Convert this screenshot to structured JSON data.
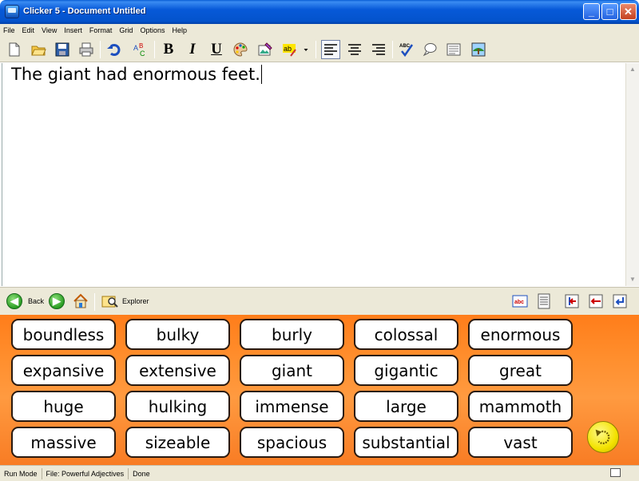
{
  "window": {
    "title": "Clicker 5 - Document Untitled",
    "controls": {
      "minimize": "_",
      "maximize": "□",
      "close": "✕"
    }
  },
  "menu": [
    "File",
    "Edit",
    "View",
    "Insert",
    "Format",
    "Grid",
    "Options",
    "Help"
  ],
  "toolbar": {
    "items": [
      "new-document-icon",
      "open-folder-icon",
      "save-disk-icon",
      "print-icon",
      "undo-icon",
      "spell-letters-icon",
      "bold",
      "italic",
      "underline",
      "colour-palette-icon",
      "picture-paint-icon",
      "highlight-ab-icon",
      "dropdown-arrow-icon",
      "align-left-icon",
      "align-center-icon",
      "align-right-icon",
      "spellcheck-icon",
      "speech-bubble-icon",
      "text-page-icon",
      "picture-frame-icon"
    ],
    "bold_label": "B",
    "italic_label": "I",
    "underline_label": "U"
  },
  "document": {
    "text": "The giant had enormous feet."
  },
  "nav": {
    "back_label": "Back",
    "explorer_label": "Explorer",
    "right_icons": [
      "abc-icon",
      "list-page-icon",
      "previous-page-icon",
      "back-arrow-icon",
      "enter-icon"
    ]
  },
  "grid": {
    "rows": [
      [
        "boundless",
        "bulky",
        "burly",
        "colossal",
        "enormous"
      ],
      [
        "expansive",
        "extensive",
        "giant",
        "gigantic",
        "great"
      ],
      [
        "huge",
        "hulking",
        "immense",
        "large",
        "mammoth"
      ],
      [
        "massive",
        "sizeable",
        "spacious",
        "substantial",
        "vast"
      ]
    ],
    "undo_button_icon": "yellow-undo-circle-icon"
  },
  "status": {
    "mode": "Run Mode",
    "file": "File: Powerful Adjectives",
    "state": "Done"
  },
  "colors": {
    "titlebar": "#0a5fd6",
    "grid_background": "#ff8a2a",
    "cell_background": "#ffffff",
    "undo_button": "#f3e200"
  }
}
